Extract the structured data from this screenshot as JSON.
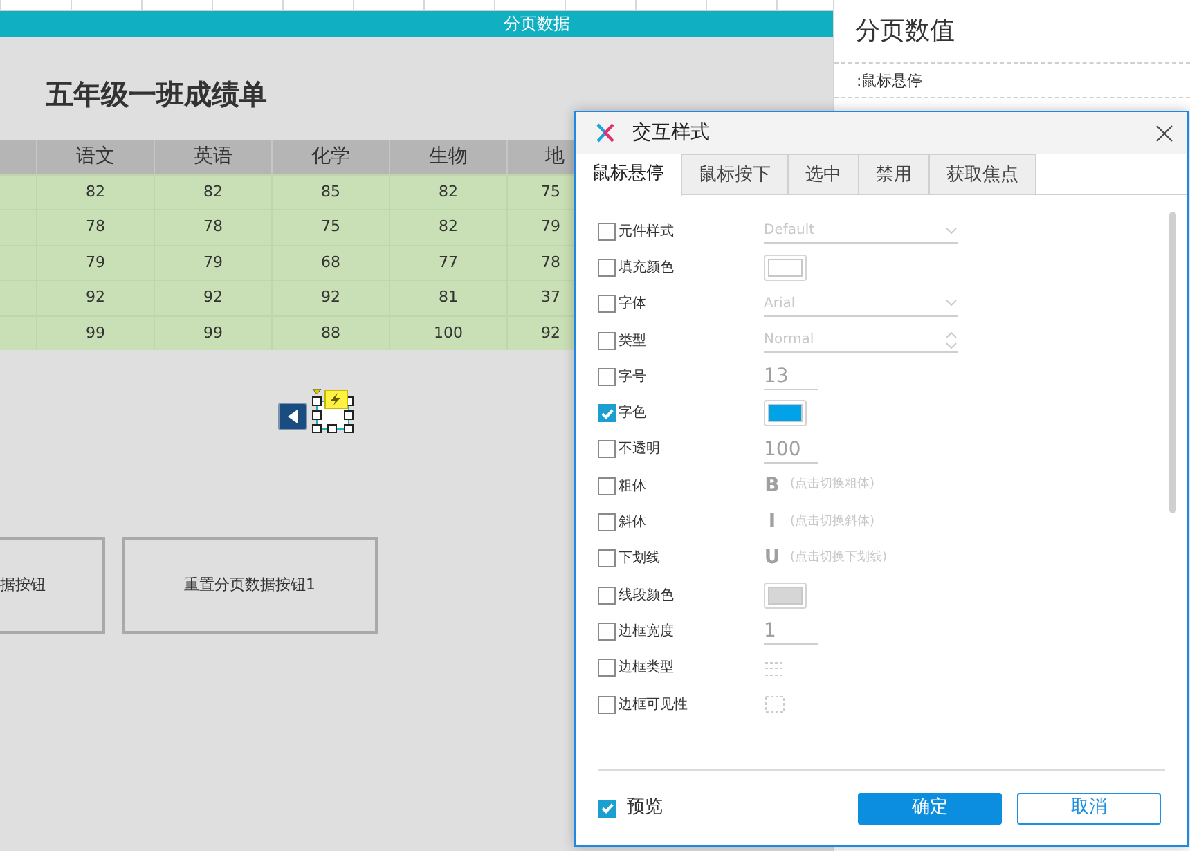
{
  "canvas": {
    "header_bar": "分页数据",
    "heading": "五年级一班成绩单",
    "table": {
      "columns": [
        "语文",
        "英语",
        "化学",
        "生物",
        "地"
      ],
      "rows": [
        [
          "82",
          "82",
          "85",
          "82",
          "75"
        ],
        [
          "78",
          "78",
          "75",
          "82",
          "79"
        ],
        [
          "79",
          "79",
          "68",
          "77",
          "78"
        ],
        [
          "92",
          "92",
          "92",
          "81",
          "37"
        ],
        [
          "99",
          "99",
          "88",
          "100",
          "92"
        ]
      ]
    },
    "buttons": [
      "据按钮",
      "重置分页数据按钮1"
    ]
  },
  "right_panel": {
    "title": "分页数值",
    "state_label": ":鼠标悬停"
  },
  "dialog": {
    "title": "交互样式",
    "tabs": [
      {
        "label": "鼠标悬停",
        "selected": true
      },
      {
        "label": "鼠标按下",
        "selected": false
      },
      {
        "label": "选中",
        "selected": false
      },
      {
        "label": "禁用",
        "selected": false
      },
      {
        "label": "获取焦点",
        "selected": false
      }
    ],
    "properties": [
      {
        "label": "元件样式",
        "checked": false,
        "kind": "select",
        "value": "Default"
      },
      {
        "label": "填充颜色",
        "checked": false,
        "kind": "color",
        "color": "#ffffff"
      },
      {
        "label": "字体",
        "checked": false,
        "kind": "select",
        "value": "Arial"
      },
      {
        "label": "类型",
        "checked": false,
        "kind": "spinner",
        "value": "Normal"
      },
      {
        "label": "字号",
        "checked": false,
        "kind": "number",
        "value": "13"
      },
      {
        "label": "字色",
        "checked": true,
        "kind": "color",
        "color": "#00a2e8"
      },
      {
        "label": "不透明",
        "checked": false,
        "kind": "number",
        "value": "100"
      },
      {
        "label": "粗体",
        "checked": false,
        "kind": "toggle",
        "glyph": "B",
        "hint": "(点击切换粗体)"
      },
      {
        "label": "斜体",
        "checked": false,
        "kind": "toggle",
        "glyph": "I",
        "hint": "(点击切换斜体)"
      },
      {
        "label": "下划线",
        "checked": false,
        "kind": "toggle",
        "glyph": "U",
        "hint": "(点击切换下划线)"
      },
      {
        "label": "线段颜色",
        "checked": false,
        "kind": "color",
        "color": "#d6d6d6"
      },
      {
        "label": "边框宽度",
        "checked": false,
        "kind": "number",
        "value": "1"
      },
      {
        "label": "边框类型",
        "checked": false,
        "kind": "line-style"
      },
      {
        "label": "边框可见性",
        "checked": false,
        "kind": "border-visibility"
      }
    ],
    "preview": {
      "label": "预览",
      "checked": true
    },
    "buttons": [
      {
        "label": "确定",
        "kind": "primary"
      },
      {
        "label": "取消",
        "kind": "secondary"
      }
    ]
  }
}
